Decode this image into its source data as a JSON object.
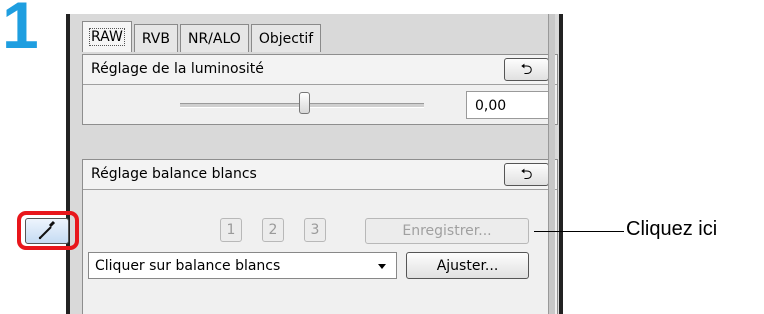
{
  "step_number": "1",
  "tabs": [
    {
      "label": "RAW",
      "active": true
    },
    {
      "label": "RVB",
      "active": false
    },
    {
      "label": "NR/ALO",
      "active": false
    },
    {
      "label": "Objectif",
      "active": false
    }
  ],
  "brightness": {
    "title": "Réglage de la luminosité",
    "reset_icon": "reset-arrow-icon",
    "reset_glyph": "⮌",
    "slider_level": 0.5,
    "value": "0,00"
  },
  "white_balance": {
    "title": "Réglage balance blancs",
    "reset_icon": "reset-arrow-icon",
    "reset_glyph": "⮌",
    "picker_icon": "eyedropper-icon",
    "presets": [
      "1",
      "2",
      "3"
    ],
    "save_label": "Enregistrer...",
    "mode_selected": "Cliquer sur balance blancs",
    "adjust_label": "Ajuster..."
  },
  "callout_text": "Cliquez ici",
  "colors": {
    "step_number": "#1e9ee0",
    "highlight": "#e8161b"
  }
}
